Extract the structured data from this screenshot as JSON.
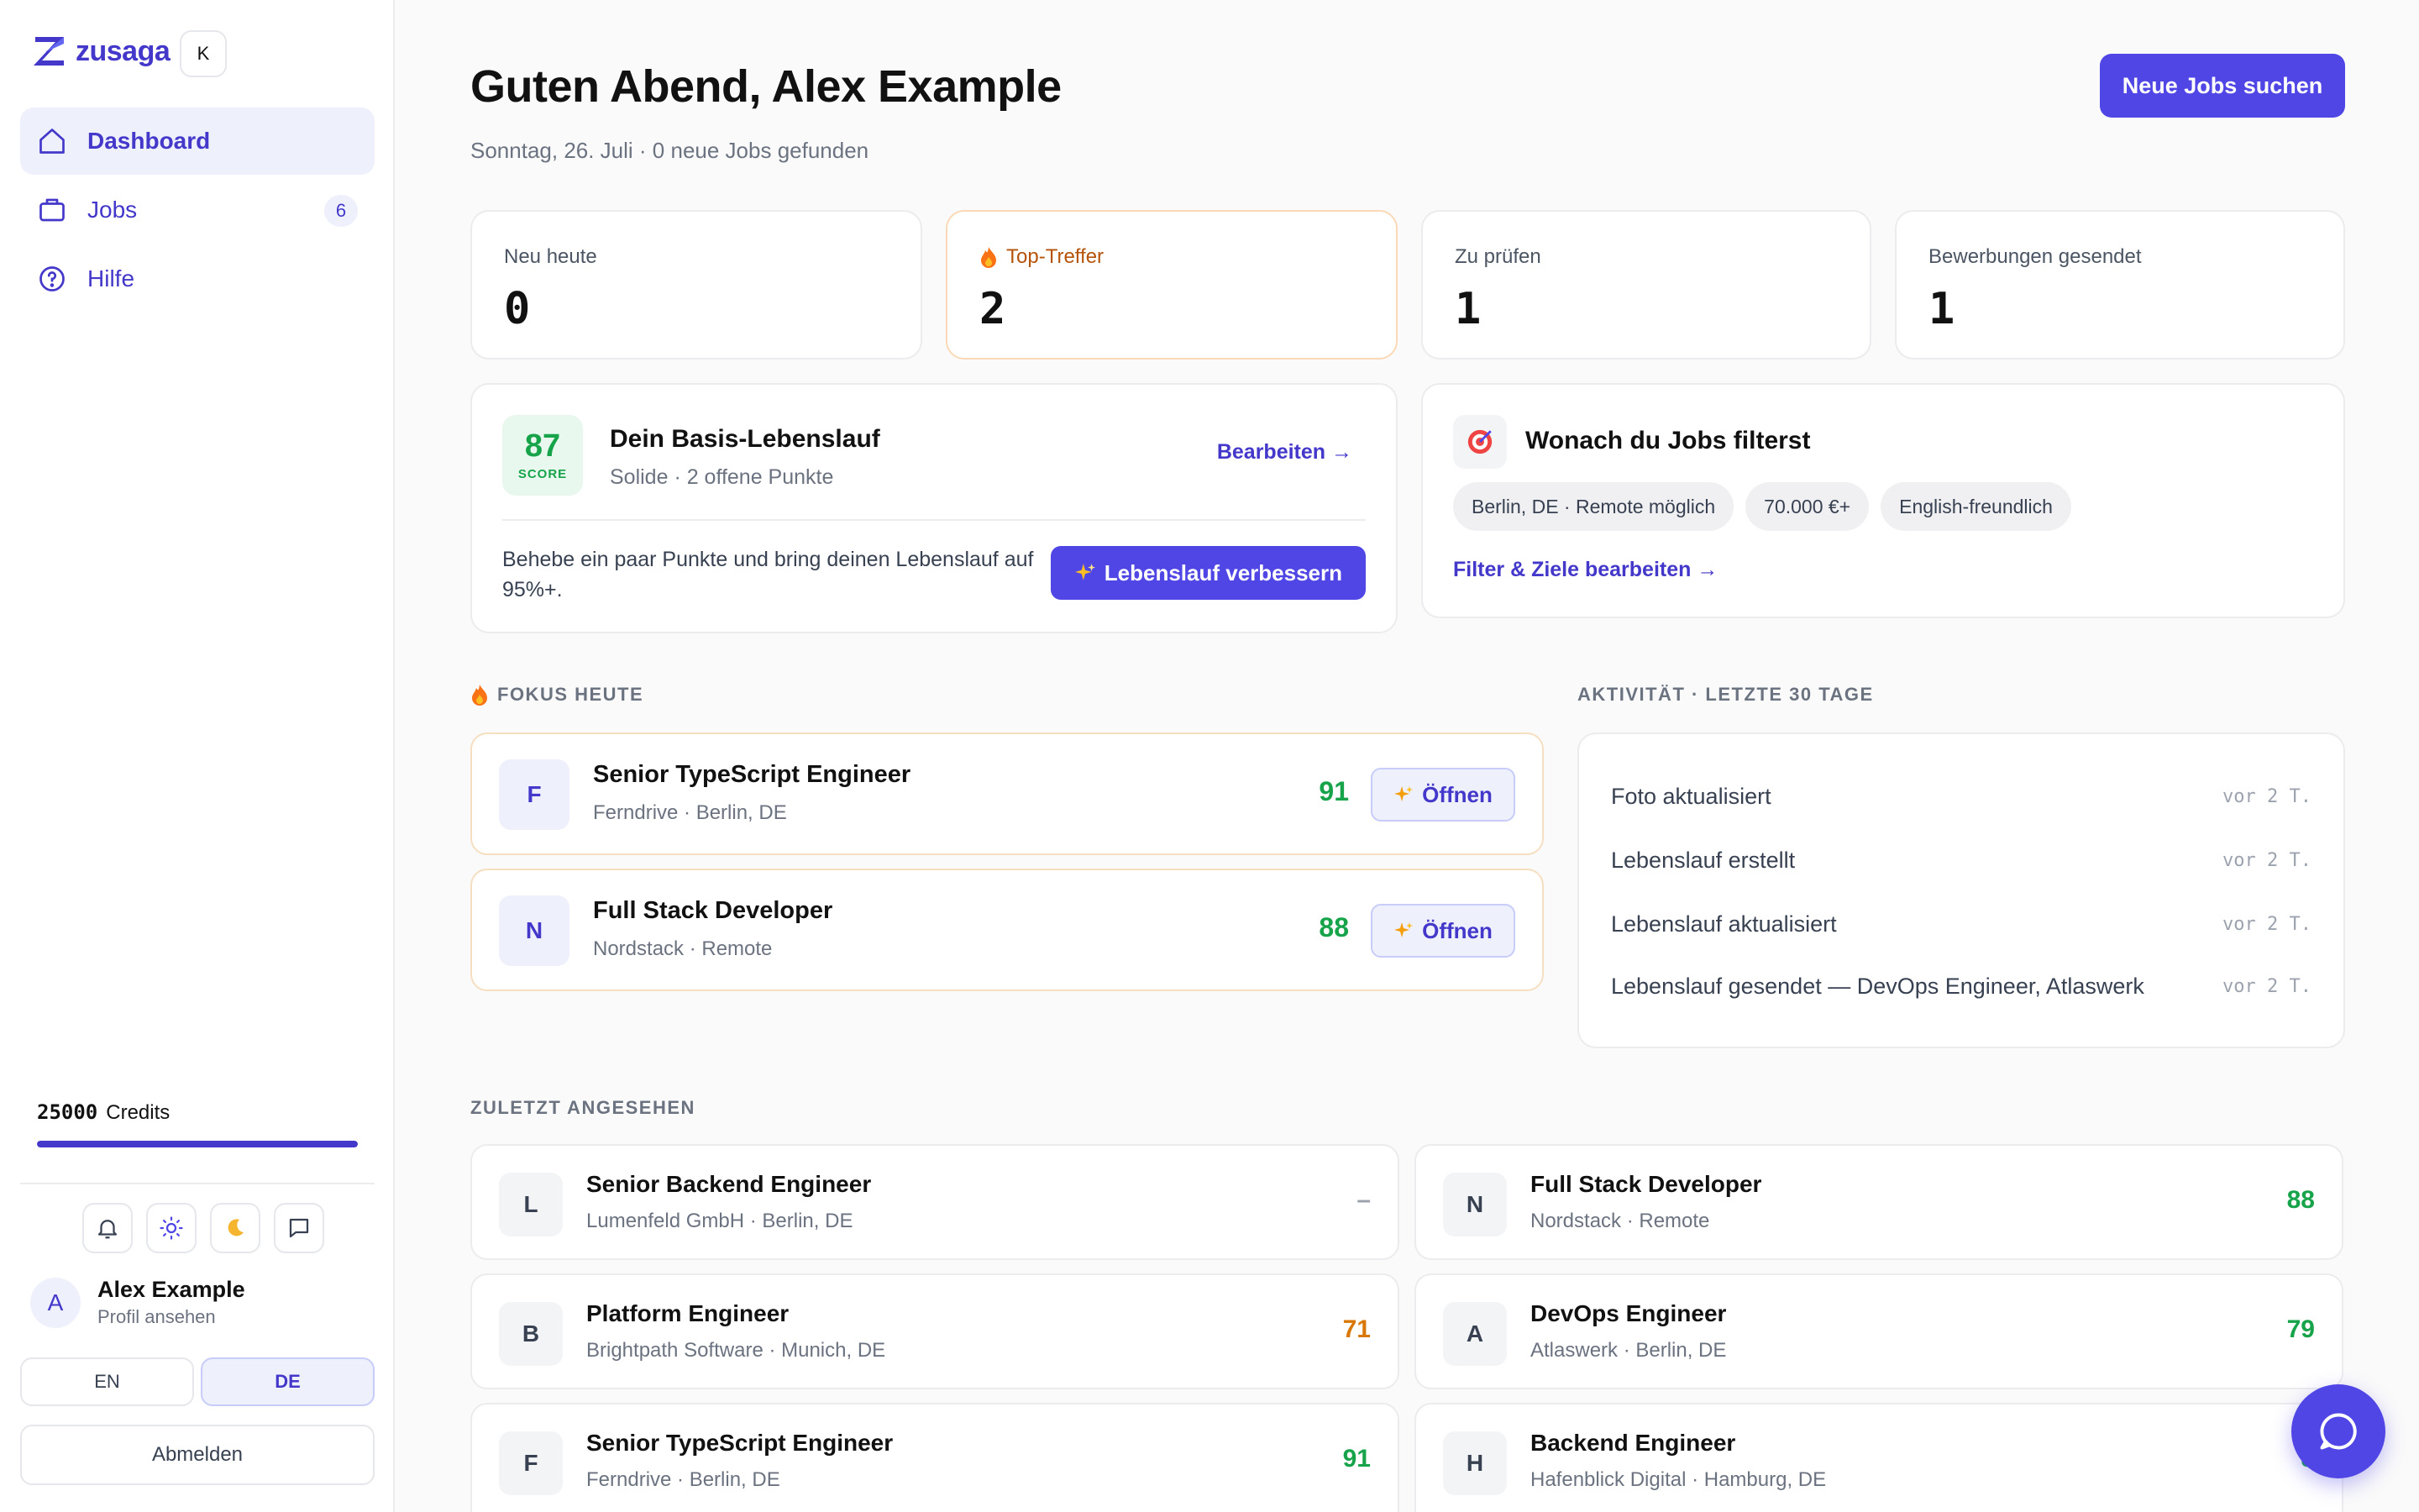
{
  "brand": {
    "name": "zusaga",
    "shortcut_key": "K"
  },
  "sidebar": {
    "items": [
      {
        "label": "Dashboard",
        "icon": "home-icon",
        "active": true
      },
      {
        "label": "Jobs",
        "icon": "briefcase-icon",
        "badge": "6"
      },
      {
        "label": "Hilfe",
        "icon": "help-circle-icon"
      }
    ],
    "credits": {
      "amount": "25000",
      "label": "Credits",
      "fill_fraction": 1.0
    },
    "icons": [
      "bell-icon",
      "sun-icon",
      "moon-icon",
      "message-icon"
    ],
    "user": {
      "initial": "A",
      "name": "Alex Example",
      "sub": "Profil ansehen"
    },
    "languages": [
      {
        "label": "EN",
        "active": false
      },
      {
        "label": "DE",
        "active": true
      }
    ],
    "logout": "Abmelden"
  },
  "header": {
    "title": "Guten Abend, Alex Example",
    "subtitle": "Sonntag, 26. Juli · 0 neue Jobs gefunden",
    "cta": "Neue Jobs suchen"
  },
  "stats": [
    {
      "label": "Neu heute",
      "value": "0"
    },
    {
      "label": "Top-Treffer",
      "value": "2",
      "highlight": true
    },
    {
      "label": "Zu prüfen",
      "value": "1"
    },
    {
      "label": "Bewerbungen gesendet",
      "value": "1"
    }
  ],
  "resume": {
    "score": "87",
    "score_label": "SCORE",
    "title": "Dein Basis-Lebenslauf",
    "subtitle": "Solide · 2 offene Punkte",
    "edit": "Bearbeiten →",
    "tip": "Behebe ein paar Punkte und bring deinen Lebenslauf auf 95%+.",
    "improve": "Lebenslauf verbessern"
  },
  "filters": {
    "title": "Wonach du Jobs filterst",
    "chips": [
      "Berlin, DE · Remote möglich",
      "70.000 €+",
      "English-freundlich"
    ],
    "edit": "Filter & Ziele bearbeiten →"
  },
  "focus": {
    "label": "FOKUS HEUTE",
    "open_label": "Öffnen",
    "items": [
      {
        "letter": "F",
        "title": "Senior TypeScript Engineer",
        "sub": "Ferndrive · Berlin, DE",
        "score": "91"
      },
      {
        "letter": "N",
        "title": "Full Stack Developer",
        "sub": "Nordstack · Remote",
        "score": "88"
      }
    ]
  },
  "activity": {
    "label": "AKTIVITÄT · LETZTE 30 TAGE",
    "items": [
      {
        "text": "Foto aktualisiert",
        "time": "vor 2 T."
      },
      {
        "text": "Lebenslauf erstellt",
        "time": "vor 2 T."
      },
      {
        "text": "Lebenslauf aktualisiert",
        "time": "vor 2 T."
      },
      {
        "text": "Lebenslauf gesendet — DevOps Engineer, Atlaswerk",
        "time": "vor 2 T."
      }
    ]
  },
  "recent": {
    "label": "ZULETZT ANGESEHEN",
    "items": [
      {
        "letter": "L",
        "title": "Senior Backend Engineer",
        "sub": "Lumenfeld GmbH · Berlin, DE",
        "score": "–"
      },
      {
        "letter": "N",
        "title": "Full Stack Developer",
        "sub": "Nordstack · Remote",
        "score": "88"
      },
      {
        "letter": "B",
        "title": "Platform Engineer",
        "sub": "Brightpath Software · Munich, DE",
        "score": "71"
      },
      {
        "letter": "A",
        "title": "DevOps Engineer",
        "sub": "Atlaswerk · Berlin, DE",
        "score": "79"
      },
      {
        "letter": "F",
        "title": "Senior TypeScript Engineer",
        "sub": "Ferndrive · Berlin, DE",
        "score": "91"
      },
      {
        "letter": "H",
        "title": "Backend Engineer",
        "sub": "Hafenblick Digital · Hamburg, DE",
        "score": "8"
      }
    ]
  },
  "colors": {
    "accent": "#4f46e5",
    "accent_text": "#4338ca",
    "score_green": "#16a34a",
    "score_orange": "#d97706"
  }
}
